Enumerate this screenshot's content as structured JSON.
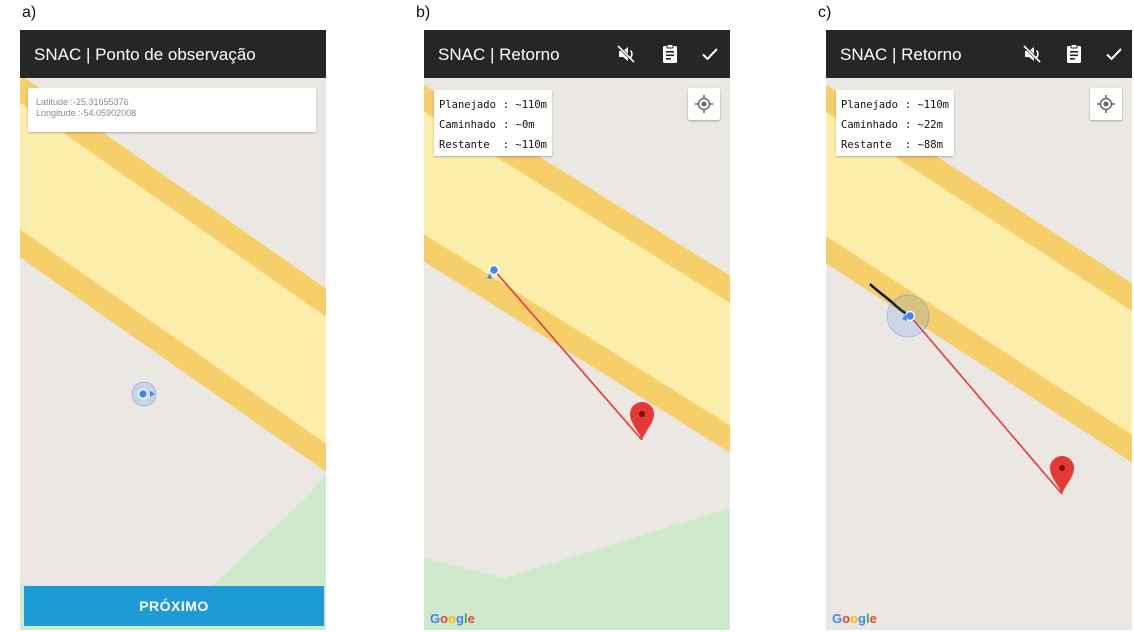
{
  "colors": {
    "appbar": "#262626",
    "map_background": "#ebe8e3",
    "road_edge": "#f6cf6a",
    "road_center": "#fbeeaa",
    "park": "#cfe9cc",
    "location_dot": "#4285f4",
    "route_line": "#e53935",
    "marker": "#e53935",
    "next_button": "#1e9ad6"
  },
  "panels": [
    {
      "label": "a)",
      "title": "SNAC | Ponto de observação",
      "latitude": "Latitude :-25.31655376",
      "longitude": "Longitude :-54.05902008",
      "next_label": "PRÓXIMO"
    },
    {
      "label": "b)",
      "title": "SNAC | Retorno",
      "icons": [
        "volume-off-icon",
        "clipboard-icon",
        "check-icon"
      ],
      "stats": [
        {
          "label": "Planejado",
          "value": ": ~110m"
        },
        {
          "label": "Caminhado",
          "value": ": ~0m"
        },
        {
          "label": "Restante",
          "value": ": ~110m"
        }
      ],
      "google": [
        "G",
        "o",
        "o",
        "g",
        "l",
        "e"
      ]
    },
    {
      "label": "c)",
      "title": "SNAC | Retorno",
      "icons": [
        "volume-off-icon",
        "clipboard-icon",
        "check-icon"
      ],
      "stats": [
        {
          "label": "Planejado",
          "value": ": ~110m"
        },
        {
          "label": "Caminhado",
          "value": ": ~22m"
        },
        {
          "label": "Restante",
          "value": ": ~88m"
        }
      ],
      "google": [
        "G",
        "o",
        "o",
        "g",
        "l",
        "e"
      ]
    }
  ]
}
